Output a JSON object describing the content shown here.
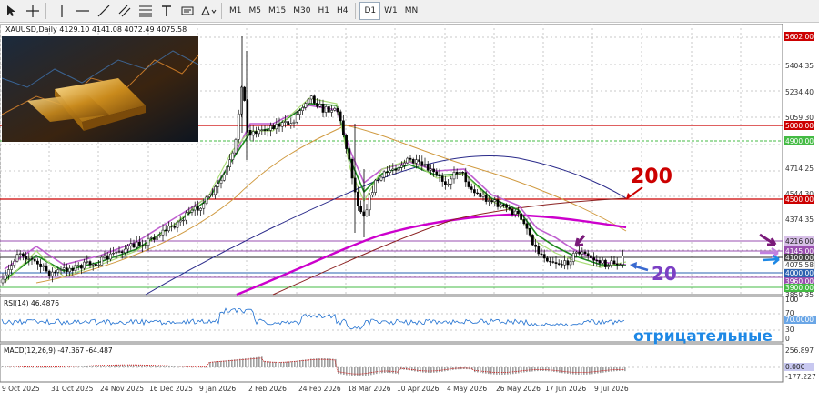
{
  "toolbar": {
    "timeframes": [
      "M1",
      "M5",
      "M15",
      "M30",
      "H1",
      "H4",
      "D1",
      "W1",
      "MN"
    ],
    "active_timeframe": "D1"
  },
  "chart": {
    "symbol_line": "XAUUSD,Daily  4129.10 4141.08 4072.49 4075.58",
    "price_labels": [
      "5602.00",
      "5404.35",
      "5234.40",
      "5059.30",
      "5000.00",
      "4900.00",
      "4714.25",
      "4544.30",
      "4500.00",
      "4374.35",
      "4216.00",
      "4145.00",
      "4100.00",
      "4075.58",
      "4000.00",
      "3960.00",
      "3900.00",
      "3859.35"
    ],
    "date_labels": [
      "9 Oct 2025",
      "31 Oct 2025",
      "24 Nov 2025",
      "16 Dec 2025",
      "9 Jan 2026",
      "2 Feb 2026",
      "24 Feb 2026",
      "18 Mar 2026",
      "10 Apr 2026",
      "4 May 2026",
      "26 May 2026",
      "17 Jun 2026",
      "9 Jul 2026"
    ],
    "annotation_200": "200",
    "annotation_20": "20",
    "annotation_negative": "отрицательные",
    "colors": {
      "level_red": "#cc0000",
      "level_green": "#44bb44",
      "ma200": "#cc00cc",
      "arrow_purple": "#7a1a7a",
      "arrow_blue": "#1e88e5",
      "annotation_text": "#cc0000",
      "annotation_20": "#7b3fc4"
    }
  },
  "rsi": {
    "label": "RSI(14) 46.4876",
    "levels": [
      "100",
      "70",
      "30",
      "0"
    ],
    "current_label": "70.0000"
  },
  "macd": {
    "label": "MACD(12,26,9) -47.367 -64.487",
    "levels": [
      "256.897",
      "0.000",
      "-177.227"
    ]
  }
}
